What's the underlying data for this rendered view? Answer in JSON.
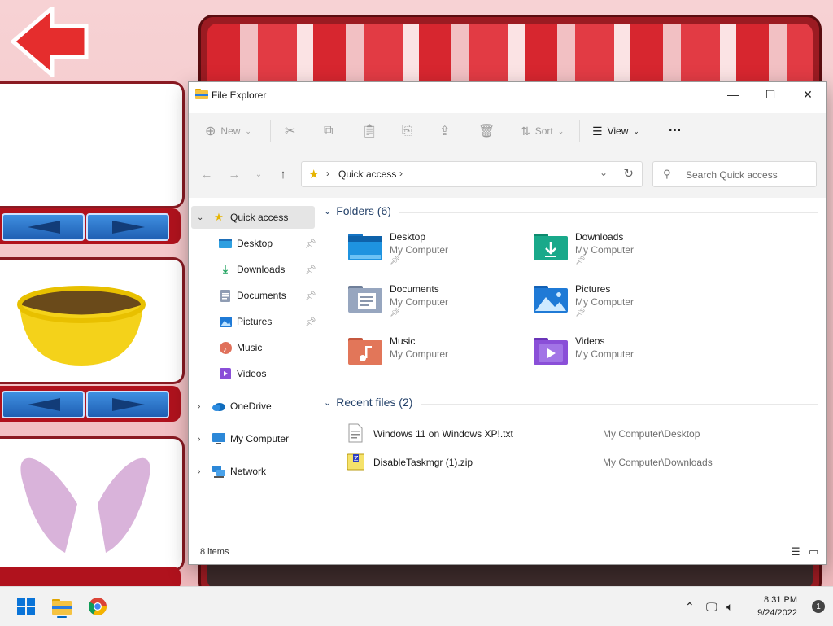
{
  "window": {
    "title": "File Explorer",
    "minimize": "—",
    "maximize": "☐",
    "close": "✕"
  },
  "toolbar": {
    "new_label": "New",
    "sort_label": "Sort",
    "view_label": "View",
    "more_label": "···"
  },
  "address": {
    "path": "Quick access",
    "search_placeholder": "Search Quick access"
  },
  "sidebar": {
    "quick_access": "Quick access",
    "pinned": [
      {
        "label": "Desktop",
        "icon": "desktop-icon"
      },
      {
        "label": "Downloads",
        "icon": "downloads-icon"
      },
      {
        "label": "Documents",
        "icon": "documents-icon"
      },
      {
        "label": "Pictures",
        "icon": "pictures-icon"
      },
      {
        "label": "Music",
        "icon": "music-icon"
      },
      {
        "label": "Videos",
        "icon": "videos-icon"
      }
    ],
    "onedrive": "OneDrive",
    "my_computer": "My Computer",
    "network": "Network"
  },
  "folders": {
    "header": "Folders (6)",
    "items": [
      {
        "name": "Desktop",
        "location": "My Computer",
        "pinned": true
      },
      {
        "name": "Downloads",
        "location": "My Computer",
        "pinned": true
      },
      {
        "name": "Documents",
        "location": "My Computer",
        "pinned": true
      },
      {
        "name": "Pictures",
        "location": "My Computer",
        "pinned": true
      },
      {
        "name": "Music",
        "location": "My Computer",
        "pinned": false
      },
      {
        "name": "Videos",
        "location": "My Computer",
        "pinned": false
      }
    ]
  },
  "recent": {
    "header": "Recent files (2)",
    "items": [
      {
        "name": "Windows 11 on Windows XP!.txt",
        "location": "My Computer\\Desktop"
      },
      {
        "name": "DisableTaskmgr (1).zip",
        "location": "My Computer\\Downloads"
      }
    ]
  },
  "status": {
    "count": "8 items"
  },
  "taskbar": {
    "time": "8:31 PM",
    "date": "9/24/2022",
    "notifications": "1"
  },
  "colors": {
    "accent": "#0067c0",
    "folder_yellow": "#f5c342",
    "background_pink": "#f6c9cc"
  }
}
